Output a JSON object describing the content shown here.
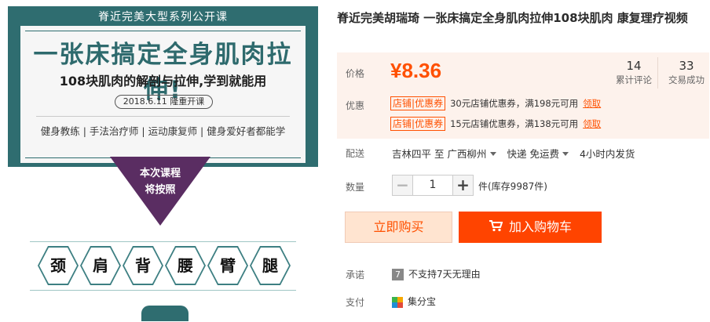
{
  "product": {
    "title": "脊近完美胡瑞琦 一张床搞定全身肌肉拉伸108块肌肉 康复理疗视频"
  },
  "image": {
    "series_banner": "脊近完美大型系列公开课",
    "main_title": "一张床搞定全身肌肉拉伸!",
    "sub_title": "108块肌肉的解剖与拉伸,学到就能用",
    "date": "2018.6.11 隆重开课",
    "audience": "健身教练 | 手法治疗师 | 运动康复师 | 健身爱好者都能学",
    "course_line1": "本次课程",
    "course_line2": "将按照",
    "body_parts": [
      "颈",
      "肩",
      "背",
      "腰",
      "臂",
      "腿"
    ]
  },
  "price": {
    "label": "价格",
    "value": "¥8.36"
  },
  "stats": {
    "reviews_count": "14",
    "reviews_label": "累计评论",
    "deals_count": "33",
    "deals_label": "交易成功"
  },
  "promo": {
    "label": "优惠",
    "coupons": [
      {
        "tag_a": "店铺",
        "tag_b": "优惠券",
        "text": "30元店铺优惠券，满198元可用",
        "claim": "领取"
      },
      {
        "tag_a": "店铺",
        "tag_b": "优惠券",
        "text": "15元店铺优惠券，满138元可用",
        "claim": "领取"
      }
    ]
  },
  "shipping": {
    "label": "配送",
    "from": "吉林四平",
    "to_word": "至",
    "dest": "广西柳州",
    "method": "快递 免运费",
    "dispatch": "4小时内发货"
  },
  "quantity": {
    "label": "数量",
    "value": "1",
    "minus": "−",
    "plus": "+",
    "stock": "件(库存9987件)"
  },
  "actions": {
    "buy_now": "立即购买",
    "add_to_cart": "加入购物车"
  },
  "promise": {
    "label": "承诺",
    "icon_text": "7",
    "text": "不支持7天无理由"
  },
  "payment": {
    "label": "支付",
    "text": "集分宝"
  },
  "colors": {
    "accent": "#ff5000",
    "cart_button": "#ff4400",
    "banner_teal": "#2f6d70",
    "triangle_purple": "#5a2d62"
  }
}
